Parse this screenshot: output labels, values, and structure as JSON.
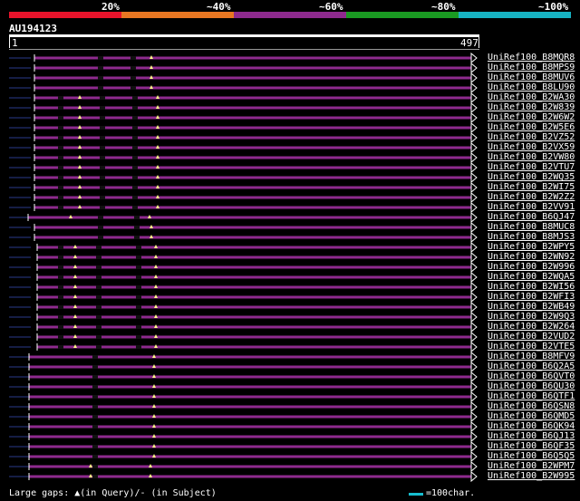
{
  "legend": {
    "labels": [
      "20%",
      "~40%",
      "~60%",
      "~80%",
      "~100%"
    ],
    "colors": [
      "#e8132b",
      "#e87722",
      "#8e2a8e",
      "#1a9a22",
      "#17b3c3"
    ]
  },
  "query": {
    "title": "AU194123",
    "start": "1",
    "end": "497"
  },
  "hit_color": "#8e2a8e",
  "hits": [
    "UniRef100_B8MQR8",
    "UniRef100_B8MPS9",
    "UniRef100_B8MUV6",
    "UniRef100_B8LU90",
    "UniRef100_B2WA30",
    "UniRef100_B2W839",
    "UniRef100_B2W6W2",
    "UniRef100_B2W5E6",
    "UniRef100_B2VZ52",
    "UniRef100_B2VX59",
    "UniRef100_B2VW80",
    "UniRef100_B2VTU7",
    "UniRef100_B2WQ35",
    "UniRef100_B2WI75",
    "UniRef100_B2W2Z2",
    "UniRef100_B2VV91",
    "UniRef100_B6QJ47",
    "UniRef100_B8MUC8",
    "UniRef100_B8MJS3",
    "UniRef100_B2WPY5",
    "UniRef100_B2WN92",
    "UniRef100_B2W996",
    "UniRef100_B2WQA5",
    "UniRef100_B2WI56",
    "UniRef100_B2WFI3",
    "UniRef100_B2WB49",
    "UniRef100_B2W9Q3",
    "UniRef100_B2W264",
    "UniRef100_B2VUD2",
    "UniRef100_B2VTE5",
    "UniRef100_B8MFV9",
    "UniRef100_B6Q2A5",
    "UniRef100_B6QVT0",
    "UniRef100_B6QU30",
    "UniRef100_B6QTF1",
    "UniRef100_B6QSN8",
    "UniRef100_B6QMD5",
    "UniRef100_B6QK94",
    "UniRef100_B6QJ13",
    "UniRef100_B6QF35",
    "UniRef100_B6Q5Q5",
    "UniRef100_B2WPM7",
    "UniRef100_B2W995"
  ],
  "footer": {
    "gaps_label": "Large gaps: ▲(in Query)/- (in Subject)",
    "scale_label": "=100char."
  }
}
